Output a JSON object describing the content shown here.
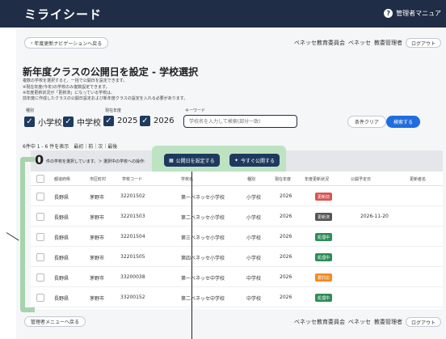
{
  "header": {
    "logo": "ミライシード",
    "help_label": "管理者マニュア"
  },
  "nav": {
    "back_label": "年度更新ナビゲーションへ戻る",
    "footer_back_label": "管理者メニューへ戻る"
  },
  "user": {
    "org": "ベネッセ教育委員会",
    "name": "ベネッセ",
    "role": "教委管理者",
    "logout_label": "ログアウト"
  },
  "page": {
    "title": "新年度クラスの公開日を設定 - 学校選択",
    "desc_lines": [
      "複数の学校を選択すると、一括で公開日を設定できます。",
      "※現在年度(今年)の学校のみ復数設定できます。",
      "※年度更新状況が「更新済」になっている学校は、",
      "前年度に作成したクラスの公開日設定および新年度クラスの設定を入れる必要があります。"
    ]
  },
  "filters": {
    "school_type_label": "種別",
    "year_label": "現在年度",
    "keyword_label": "キーワード",
    "school_types": [
      "小学校",
      "中学校"
    ],
    "years": [
      "2025",
      "2026"
    ],
    "search_placeholder": "学校名を入力して検索(部分一致)",
    "clear_label": "条件クリア",
    "search_label": "検索する"
  },
  "paging": {
    "text": "6件中 1 - 6 件を表示　最初｜前｜次｜最後"
  },
  "selection": {
    "count": "0",
    "text": "件の学校を選択しています。＞ 選択中の学校への操作:",
    "set_date_label": "公開日を設定する",
    "publish_now_label": "今すぐ公開する"
  },
  "table": {
    "headers": [
      "都道府県",
      "市区町村",
      "学校コード",
      "学校名",
      "種別",
      "現在年度",
      "年度更新状況",
      "公開予定日",
      "更新者名"
    ],
    "rows": [
      {
        "pref": "長野県",
        "city": "茅野市",
        "code": "32201502",
        "name": "第一ベネッセ小学校",
        "type": "小学校",
        "year": "2026",
        "status": "更新前",
        "date": "",
        "user": ""
      },
      {
        "pref": "長野県",
        "city": "茅野市",
        "code": "32201503",
        "name": "第二ベネッセ小学校",
        "type": "小学校",
        "year": "2026",
        "status": "更新済",
        "date": "2026-11-20",
        "user": ""
      },
      {
        "pref": "長野県",
        "city": "茅野市",
        "code": "32201504",
        "name": "第三ベネッセ小学校",
        "type": "小学校",
        "year": "2026",
        "status": "処理中",
        "date": "",
        "user": ""
      },
      {
        "pref": "長野県",
        "city": "茅野市",
        "code": "32201505",
        "name": "第四ベネッセ小学校",
        "type": "小学校",
        "year": "2026",
        "status": "処理中",
        "date": "",
        "user": ""
      },
      {
        "pref": "長野県",
        "city": "茅野市",
        "code": "33200038",
        "name": "第一ベネッセ中学校",
        "type": "中学校",
        "year": "2026",
        "status": "要対応",
        "date": "",
        "user": ""
      },
      {
        "pref": "長野県",
        "city": "茅野市",
        "code": "33200152",
        "name": "第二ベネッセ中学校",
        "type": "中学校",
        "year": "2026",
        "status": "処理中",
        "date": "",
        "user": ""
      }
    ]
  },
  "status_colors": {
    "更新前": "#d9534f",
    "更新済": "#555555",
    "処理中": "#2e8b57",
    "要対応": "#f08a24"
  },
  "colors": {
    "header_bg": "#1f2d46",
    "accent_blue": "#1f6dde",
    "highlight_green": "#a5d4ae",
    "action_navy": "#1f3a5f"
  }
}
